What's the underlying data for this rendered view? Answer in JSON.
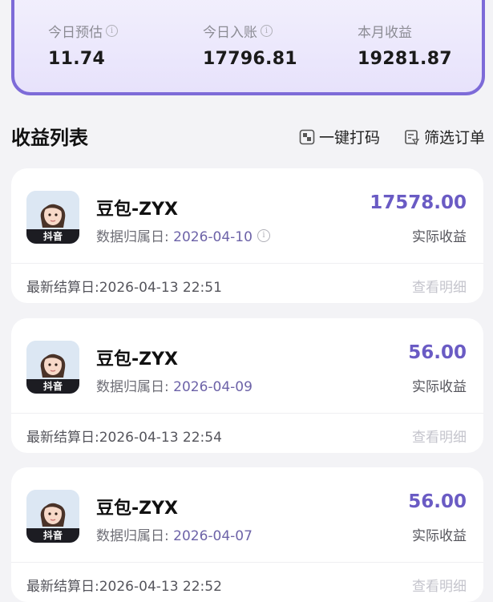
{
  "summary": {
    "items": [
      {
        "label": "今日预估",
        "value": "11.74",
        "info": true
      },
      {
        "label": "今日入账",
        "value": "17796.81",
        "info": true
      },
      {
        "label": "本月收益",
        "value": "19281.87",
        "info": false
      }
    ]
  },
  "list": {
    "title": "收益列表",
    "actions": [
      {
        "label": "一键打码",
        "icon": "mosaic-icon"
      },
      {
        "label": "筛选订单",
        "icon": "filter-order-icon"
      }
    ],
    "items": [
      {
        "platform": "抖音",
        "name": "豆包-ZYX",
        "date_label": "数据归属日: ",
        "date": "2026-04-10",
        "amount": "17578.00",
        "amount_label": "实际收益",
        "settle": "最新结算日:2026-04-13 22:51",
        "detail": "查看明细"
      },
      {
        "platform": "抖音",
        "name": "豆包-ZYX",
        "date_label": "数据归属日: ",
        "date": "2026-04-09",
        "amount": "56.00",
        "amount_label": "实际收益",
        "settle": "最新结算日:2026-04-13 22:54",
        "detail": "查看明细"
      },
      {
        "platform": "抖音",
        "name": "豆包-ZYX",
        "date_label": "数据归属日: ",
        "date": "2026-04-07",
        "amount": "56.00",
        "amount_label": "实际收益",
        "settle": "最新结算日:2026-04-13 22:52",
        "detail": "查看明细"
      }
    ]
  },
  "colors": {
    "accent": "#6a5bc4",
    "card_border": "#7d6bd8"
  }
}
